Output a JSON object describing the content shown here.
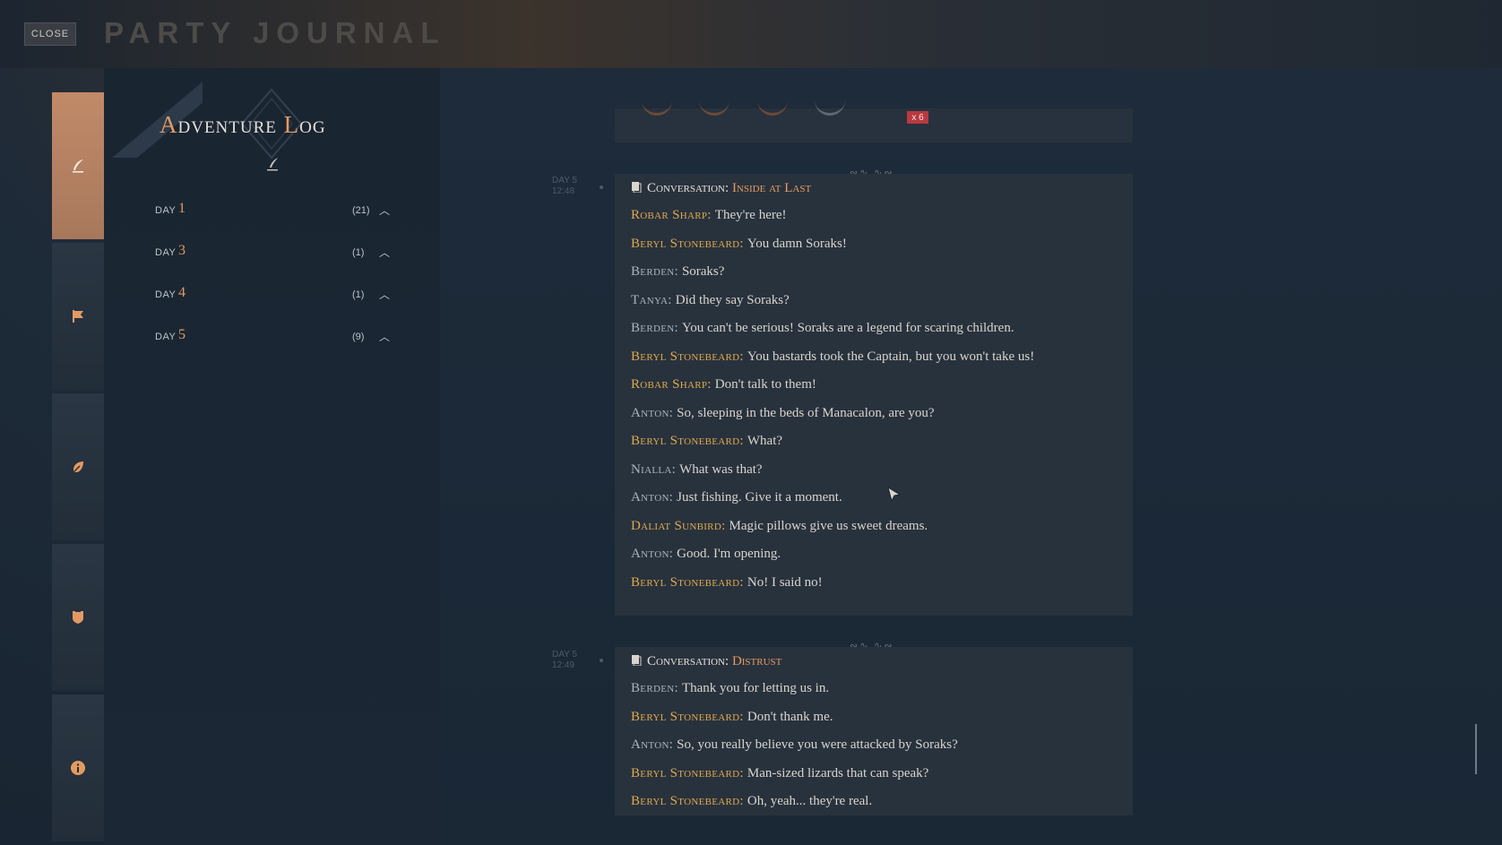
{
  "header": {
    "close_label": "CLOSE",
    "title": "PARTY JOURNAL"
  },
  "sidenav": {
    "tabs": [
      {
        "icon": "quill-icon",
        "active": true
      },
      {
        "icon": "flag-icon",
        "active": false
      },
      {
        "icon": "feather-icon",
        "active": false
      },
      {
        "icon": "shield-icon",
        "active": false
      },
      {
        "icon": "info-icon",
        "active": false
      }
    ]
  },
  "log": {
    "title_cap1": "A",
    "title_rest1": "dventure ",
    "title_cap2": "L",
    "title_rest2": "og",
    "days": [
      {
        "label": "DAY",
        "number": "1",
        "count": "(21)"
      },
      {
        "label": "DAY",
        "number": "3",
        "count": "(1)"
      },
      {
        "label": "DAY",
        "number": "4",
        "count": "(1)"
      },
      {
        "label": "DAY",
        "number": "5",
        "count": "(9)"
      }
    ]
  },
  "top_card": {
    "badge": "x 6"
  },
  "conversations": [
    {
      "stamp_day": "DAY 5",
      "stamp_time": "12:48",
      "prefix": "Conversation:",
      "subject": "Inside at Last",
      "lines": [
        {
          "speaker": "Robar Sharp:",
          "text": "They're here!",
          "tone": "gold"
        },
        {
          "speaker": "Beryl Stonebeard:",
          "text": "You damn Soraks!",
          "tone": "gold"
        },
        {
          "speaker": "Berden:",
          "text": "Soraks?",
          "tone": "grey"
        },
        {
          "speaker": "Tanya:",
          "text": "Did they say Soraks?",
          "tone": "grey"
        },
        {
          "speaker": "Berden:",
          "text": "You can't be serious! Soraks are a legend for scaring children.",
          "tone": "grey"
        },
        {
          "speaker": "Beryl Stonebeard:",
          "text": "You bastards took the Captain, but you won't take us!",
          "tone": "gold"
        },
        {
          "speaker": "Robar Sharp:",
          "text": "Don't talk to them!",
          "tone": "gold"
        },
        {
          "speaker": "Anton:",
          "text": "So, sleeping in the beds of Manacalon, are you?",
          "tone": "grey"
        },
        {
          "speaker": "Beryl Stonebeard:",
          "text": "What?",
          "tone": "gold"
        },
        {
          "speaker": "Nialla:",
          "text": "What was that?",
          "tone": "grey"
        },
        {
          "speaker": "Anton:",
          "text": "Just fishing. Give it a moment.",
          "tone": "grey"
        },
        {
          "speaker": "Daliat Sunbird:",
          "text": "Magic pillows give us sweet dreams.",
          "tone": "gold"
        },
        {
          "speaker": "Anton:",
          "text": "Good. I'm opening.",
          "tone": "grey"
        },
        {
          "speaker": "Beryl Stonebeard:",
          "text": "No! I said no!",
          "tone": "gold"
        }
      ]
    },
    {
      "stamp_day": "DAY 5",
      "stamp_time": "12:49",
      "prefix": "Conversation:",
      "subject": "Distrust",
      "lines": [
        {
          "speaker": "Berden:",
          "text": "Thank you for letting us in.",
          "tone": "grey"
        },
        {
          "speaker": "Beryl Stonebeard:",
          "text": "Don't thank me.",
          "tone": "gold"
        },
        {
          "speaker": "Anton:",
          "text": "So, you really believe you were attacked by Soraks?",
          "tone": "grey"
        },
        {
          "speaker": "Beryl Stonebeard:",
          "text": "Man-sized lizards that can speak?",
          "tone": "gold"
        },
        {
          "speaker": "Beryl Stonebeard:",
          "text": "Oh, yeah... they're real.",
          "tone": "gold"
        }
      ]
    }
  ],
  "colors": {
    "accent": "#e39a62",
    "speaker_gold": "#e0a94d",
    "speaker_grey": "#aab4bf",
    "badge_red": "#b8393f"
  }
}
